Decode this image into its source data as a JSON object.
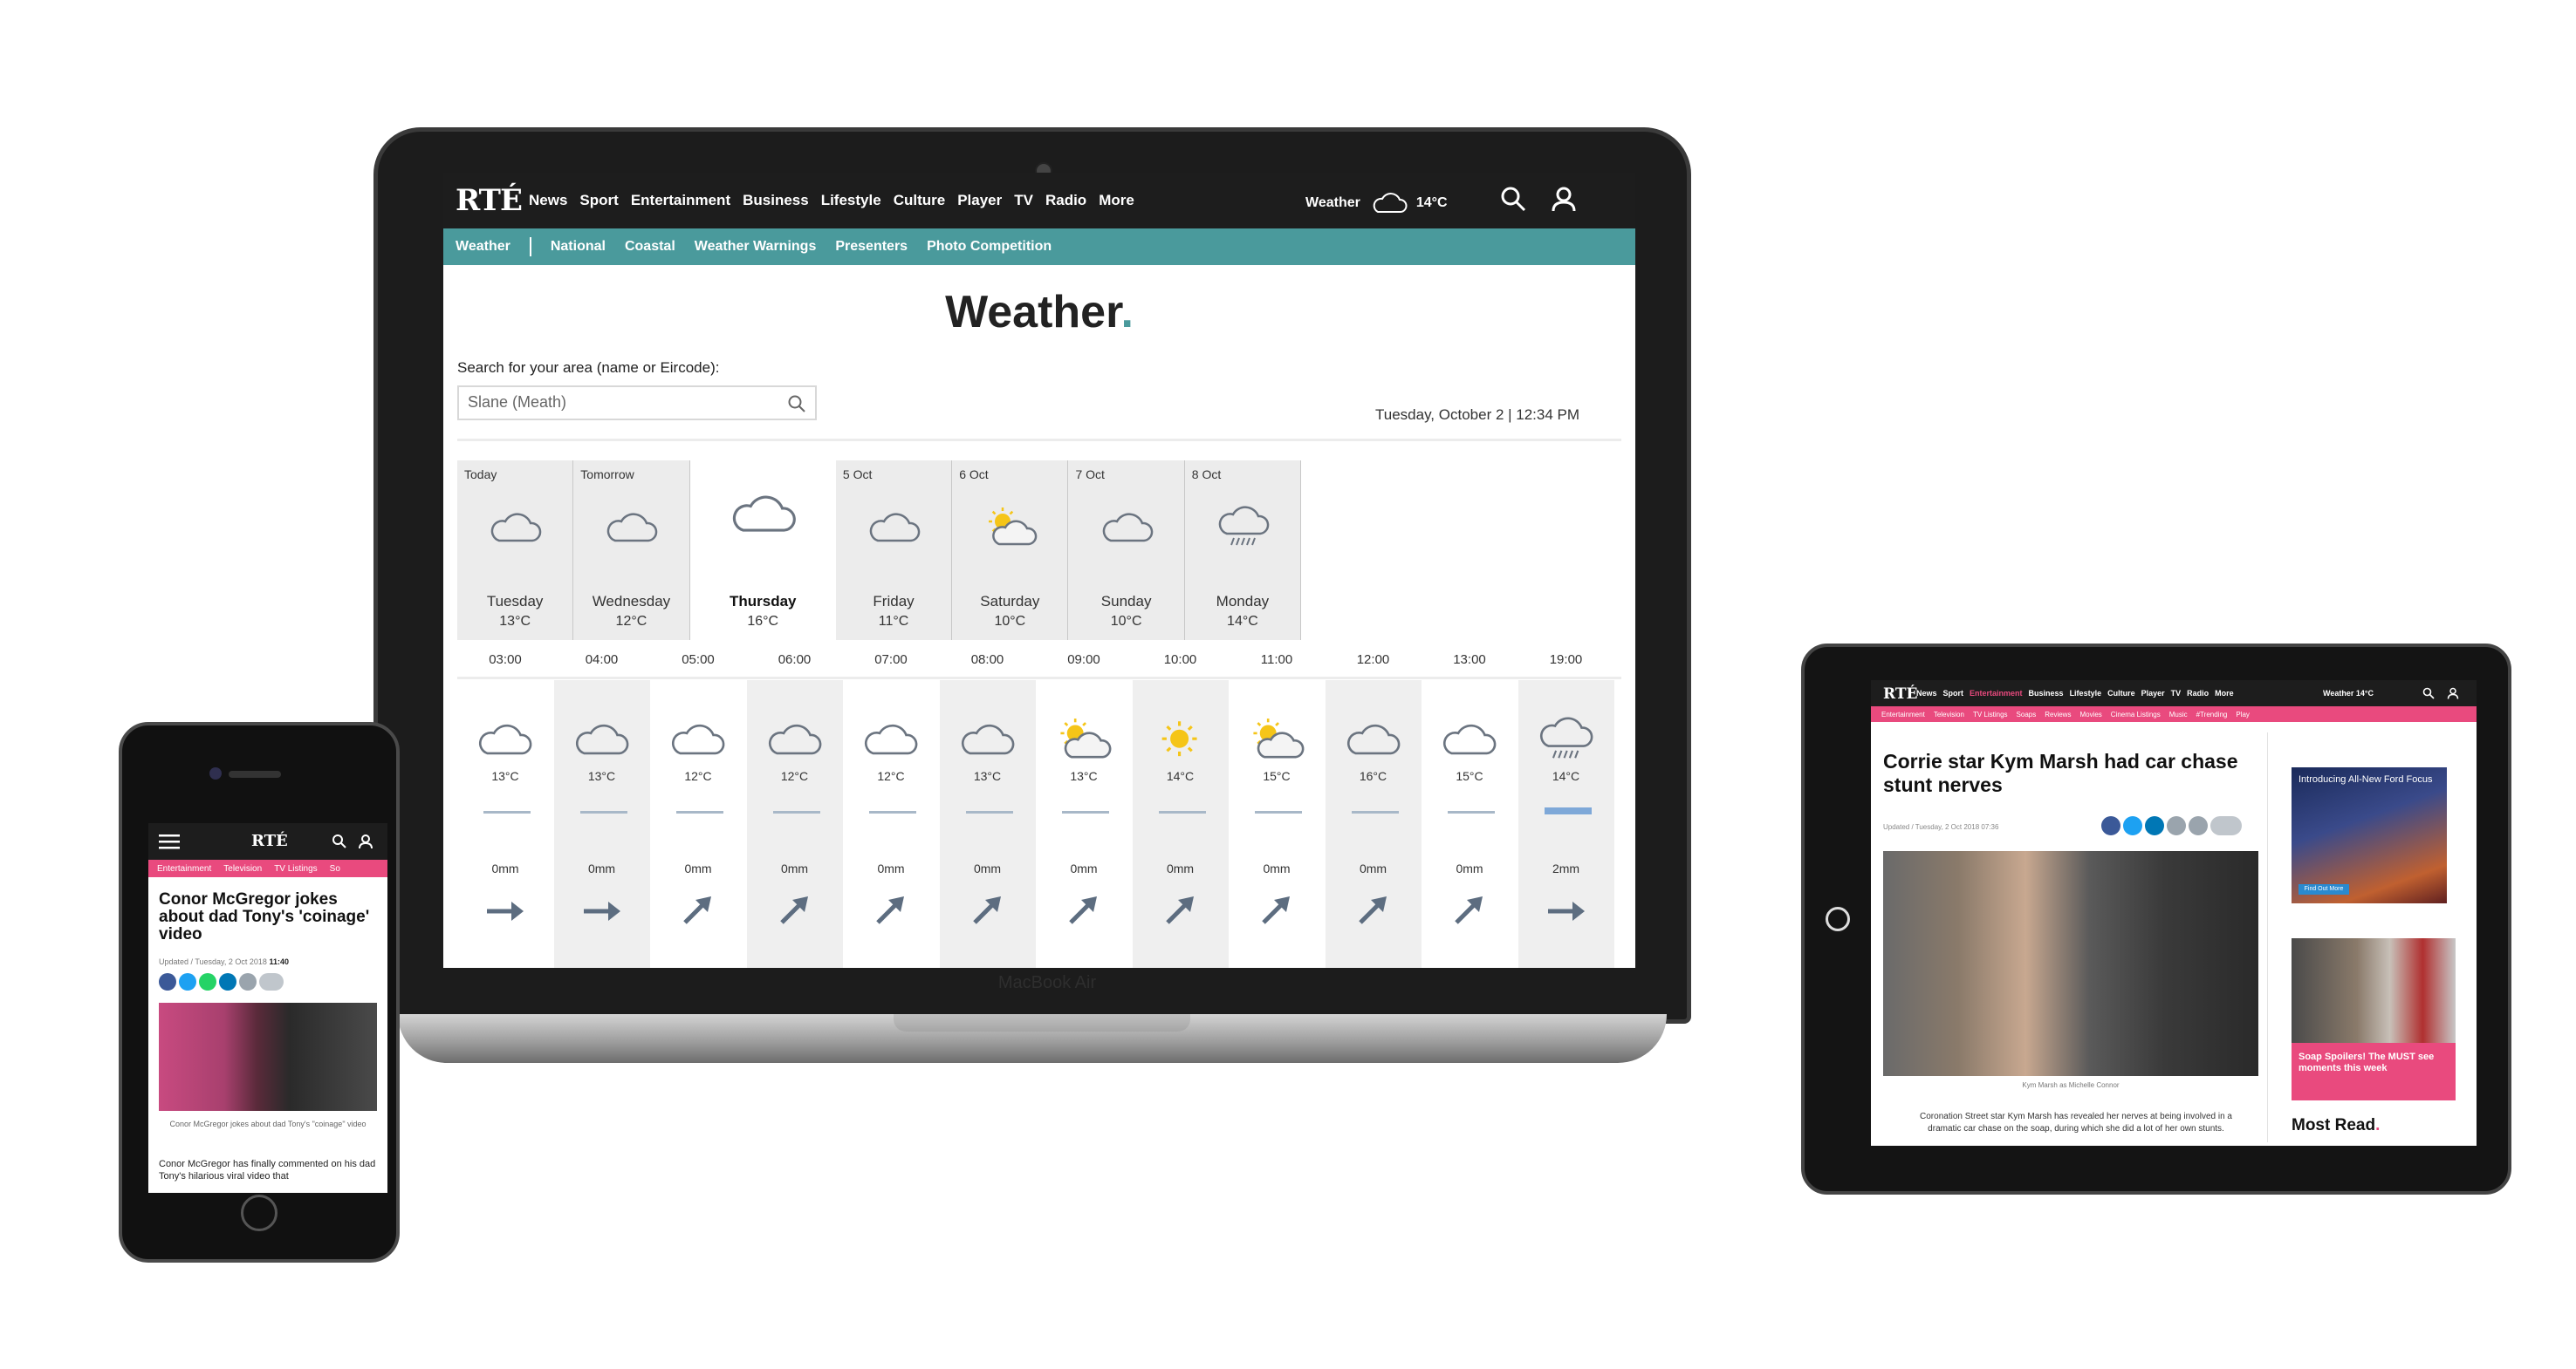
{
  "laptop": {
    "brand_label": "MacBook Air",
    "nav": {
      "logo": "RTÉ",
      "items": [
        "News",
        "Sport",
        "Entertainment",
        "Business",
        "Lifestyle",
        "Culture",
        "Player",
        "TV",
        "Radio",
        "More"
      ],
      "weather_label": "Weather",
      "weather_temp": "14°C"
    },
    "subnav": {
      "home": "Weather",
      "items": [
        "National",
        "Coastal",
        "Weather Warnings",
        "Presenters",
        "Photo Competition"
      ]
    },
    "page_title": "Weather",
    "title_dot": ".",
    "search": {
      "label": "Search for your area (name or Eircode):",
      "value": "Slane (Meath)"
    },
    "date": "Tuesday, October 2  |  12:34 PM",
    "days": [
      {
        "label": "Today",
        "icon": "cloud-icon",
        "name": "Tuesday",
        "temp": "13°C"
      },
      {
        "label": "Tomorrow",
        "icon": "cloud-icon",
        "name": "Wednesday",
        "temp": "12°C"
      },
      {
        "label": "",
        "icon": "cloud-icon",
        "name": "Thursday",
        "temp": "16°C",
        "selected": true
      },
      {
        "label": "5 Oct",
        "icon": "cloud-icon",
        "name": "Friday",
        "temp": "11°C"
      },
      {
        "label": "6 Oct",
        "icon": "sun-cloud-icon",
        "name": "Saturday",
        "temp": "10°C"
      },
      {
        "label": "7 Oct",
        "icon": "cloud-icon",
        "name": "Sunday",
        "temp": "10°C"
      },
      {
        "label": "8 Oct",
        "icon": "rain-cloud-icon",
        "name": "Monday",
        "temp": "14°C"
      }
    ],
    "hours": [
      {
        "time": "03:00",
        "icon": "cloud-icon",
        "temp": "13°C",
        "rain": "0mm",
        "wind": "east"
      },
      {
        "time": "04:00",
        "icon": "cloud-icon",
        "temp": "13°C",
        "rain": "0mm",
        "wind": "east"
      },
      {
        "time": "05:00",
        "icon": "cloud-icon",
        "temp": "12°C",
        "rain": "0mm",
        "wind": "northeast"
      },
      {
        "time": "06:00",
        "icon": "cloud-icon",
        "temp": "12°C",
        "rain": "0mm",
        "wind": "northeast"
      },
      {
        "time": "07:00",
        "icon": "cloud-icon",
        "temp": "12°C",
        "rain": "0mm",
        "wind": "northeast"
      },
      {
        "time": "08:00",
        "icon": "cloud-icon",
        "temp": "13°C",
        "rain": "0mm",
        "wind": "northeast"
      },
      {
        "time": "09:00",
        "icon": "sun-cloud-icon",
        "temp": "13°C",
        "rain": "0mm",
        "wind": "northeast"
      },
      {
        "time": "10:00",
        "icon": "sun-icon",
        "temp": "14°C",
        "rain": "0mm",
        "wind": "northeast"
      },
      {
        "time": "11:00",
        "icon": "sun-cloud-icon",
        "temp": "15°C",
        "rain": "0mm",
        "wind": "northeast"
      },
      {
        "time": "12:00",
        "icon": "cloud-icon",
        "temp": "16°C",
        "rain": "0mm",
        "wind": "northeast"
      },
      {
        "time": "13:00",
        "icon": "cloud-icon",
        "temp": "15°C",
        "rain": "0mm",
        "wind": "northeast"
      },
      {
        "time": "19:00",
        "icon": "rain-cloud-icon",
        "temp": "14°C",
        "rain": "2mm",
        "wind": "east"
      }
    ]
  },
  "phone": {
    "logo": "RTÉ",
    "subnav": [
      "Entertainment",
      "Television",
      "TV Listings",
      "So"
    ],
    "headline": "Conor McGregor jokes about dad Tony's 'coinage' video",
    "updated_prefix": "Updated / Tuesday, 2 Oct 2018",
    "updated_time": "11:40",
    "caption": "Conor McGregor jokes about dad Tony's \"coinage\" video",
    "body": "Conor McGregor has finally commented on his dad Tony's hilarious viral video that"
  },
  "tablet": {
    "logo": "RTÉ",
    "nav_items": [
      "News",
      "Sport",
      "Entertainment",
      "Business",
      "Lifestyle",
      "Culture",
      "Player",
      "TV",
      "Radio",
      "More"
    ],
    "weather": "Weather  14°C",
    "subnav": [
      "Entertainment",
      "Television",
      "TV Listings",
      "Soaps",
      "Reviews",
      "Movies",
      "Cinema Listings",
      "Music",
      "#Trending",
      "Play"
    ],
    "headline": "Corrie star Kym Marsh had car chase stunt nerves",
    "updated": "Updated / Tuesday, 2 Oct 2018 07:36",
    "caption": "Kym Marsh as Michelle Connor",
    "body": "Coronation Street star Kym Marsh has revealed her nerves at being involved in a dramatic car chase on the soap, during which she did a lot of her own stunts.",
    "ad_text": "Introducing All-New Ford Focus",
    "ad_button": "Find Out More",
    "card_text": "Soap Spoilers! The MUST see moments this week",
    "most_read": "Most Read",
    "most_read_dot": "."
  },
  "colors": {
    "teal": "#4a9a9c",
    "pink": "#e94a7e",
    "nav": "#1d1d1d"
  }
}
